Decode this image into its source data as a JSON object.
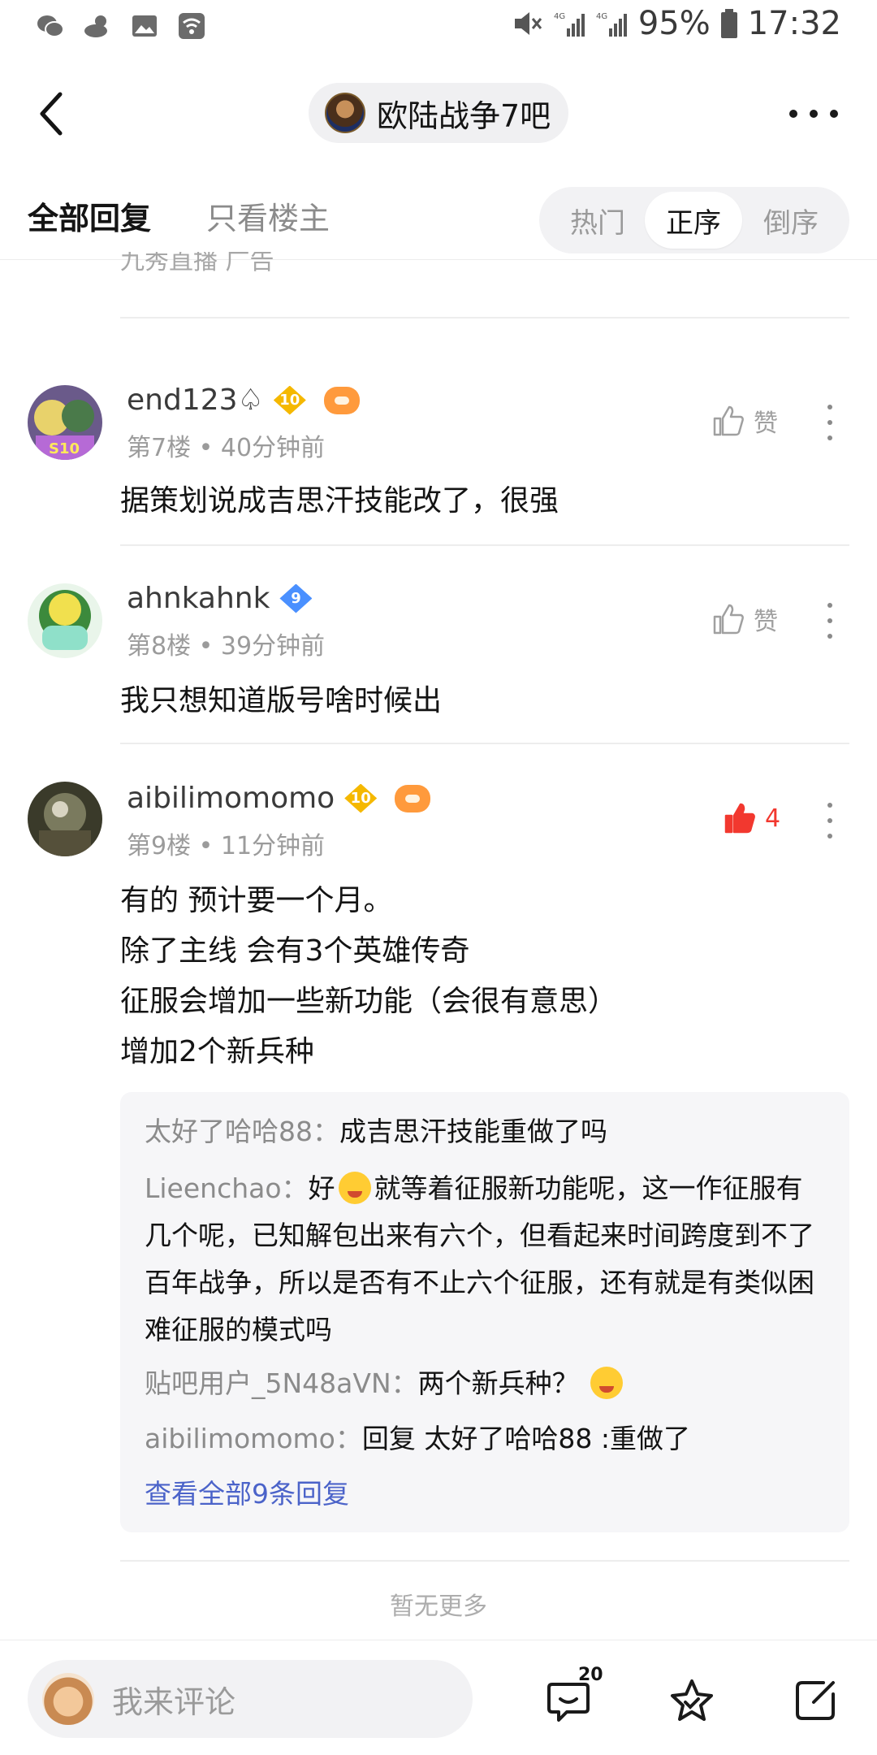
{
  "status_bar": {
    "battery": "95%",
    "time": "17:32"
  },
  "nav": {
    "forum_name": "欧陆战争7吧"
  },
  "tabs": {
    "all_replies": "全部回复",
    "op_only": "只看楼主",
    "sort": [
      "热门",
      "正序",
      "倒序"
    ],
    "sort_selected": "正序"
  },
  "ad_partial": "九秀直播 广告",
  "posts": [
    {
      "username": "end123♤",
      "level": "10",
      "floor_time": "第7楼 • 40分钟前",
      "like_label": "赞",
      "content": [
        "据策划说成吉思汗技能改了，很强"
      ]
    },
    {
      "username": "ahnkahnk",
      "level": "9",
      "floor_time": "第8楼 • 39分钟前",
      "like_label": "赞",
      "content": [
        "我只想知道版号啥时候出"
      ]
    },
    {
      "username": "aibilimomomo",
      "level": "10",
      "floor_time": "第9楼 • 11分钟前",
      "like_label": "4",
      "content": [
        "有的 预计要一个月。",
        "除了主线 会有3个英雄传奇",
        "征服会增加一些新功能（会很有意思）",
        "增加2个新兵种"
      ]
    }
  ],
  "sub_replies": [
    {
      "user": "太好了哈哈88",
      "sep": "：",
      "text": "成吉思汗技能重做了吗"
    },
    {
      "user": "Lieenchao",
      "sep": "：",
      "pre": "好",
      "text": "就等着征服新功能呢，这一作征服有几个呢，已知解包出来有六个，但看起来时间跨度到不了百年战争，所以是否有不止六个征服，还有就是有类似困难征服的模式吗"
    },
    {
      "user": "贴吧用户_5N48aVN",
      "sep": "：",
      "text": "两个新兵种？"
    },
    {
      "user": "aibilimomomo",
      "sep": "：",
      "text": "回复 太好了哈哈88 :重做了"
    }
  ],
  "sub_more": "查看全部9条回复",
  "no_more": "暂无更多",
  "bottom": {
    "comment_placeholder": "我来评论",
    "comment_count": "20"
  },
  "colors": {
    "accent_link": "#4b63c9",
    "liked_red": "#f2382f",
    "level_gold": "#f5b800",
    "level_blue": "#4a90ff"
  },
  "icons": [
    "wechat-icon",
    "weather-icon",
    "gallery-icon",
    "wifi-icon",
    "mute-icon",
    "signal-icon",
    "battery-icon",
    "back-icon",
    "more-icon",
    "like-icon",
    "comment-icon",
    "star-icon",
    "share-icon"
  ]
}
